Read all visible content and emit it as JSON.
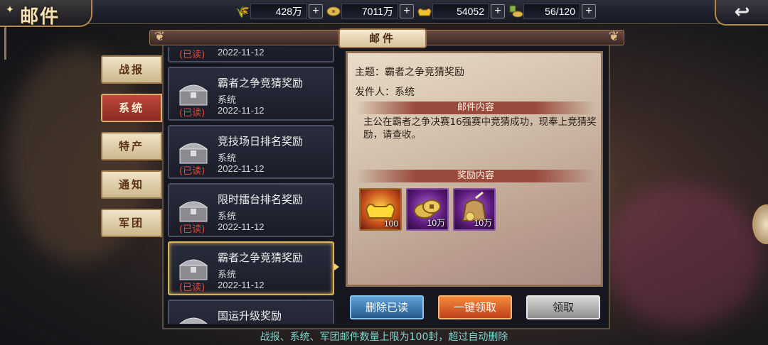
{
  "title": "邮件",
  "resources": [
    {
      "icon": "grain-icon",
      "value": "428万"
    },
    {
      "icon": "coin-icon",
      "value": "7011万"
    },
    {
      "icon": "gold-ingot-icon",
      "value": "54052"
    },
    {
      "icon": "stamina-icon",
      "value": "56/120"
    }
  ],
  "plus_label": "+",
  "header_tab": "邮件",
  "side_tabs": [
    {
      "label": "战报",
      "active": false
    },
    {
      "label": "系统",
      "active": true
    },
    {
      "label": "特产",
      "active": false
    },
    {
      "label": "通知",
      "active": false
    },
    {
      "label": "军团",
      "active": false
    }
  ],
  "mail_items": [
    {
      "subject": "",
      "sender": "",
      "status": "(已读)",
      "date": "2022-11-12",
      "selected": false
    },
    {
      "subject": "霸者之争竞猜奖励",
      "sender": "系统",
      "status": "(已读)",
      "date": "2022-11-12",
      "selected": false
    },
    {
      "subject": "竞技场日排名奖励",
      "sender": "系统",
      "status": "(已读)",
      "date": "2022-11-12",
      "selected": false
    },
    {
      "subject": "限时擂台排名奖励",
      "sender": "系统",
      "status": "(已读)",
      "date": "2022-11-12",
      "selected": false
    },
    {
      "subject": "霸者之争竞猜奖励",
      "sender": "系统",
      "status": "(已读)",
      "date": "2022-11-12",
      "selected": true
    },
    {
      "subject": "国运升级奖励",
      "sender": "",
      "status": "",
      "date": "",
      "selected": false
    }
  ],
  "detail": {
    "subject": "主题：霸者之争竞猜奖励",
    "from": "发件人：系统",
    "content_header": "邮件内容",
    "content": "主公在霸者之争决赛16强赛中竞猜成功，现奉上竞猜奖励，请查收。",
    "reward_header": "奖励内容",
    "rewards": [
      {
        "icon": "gold-ingot-icon",
        "qty": "100"
      },
      {
        "icon": "copper-coin-icon",
        "qty": "10万"
      },
      {
        "icon": "coin-bag-icon",
        "qty": "10万"
      }
    ]
  },
  "buttons": {
    "delete_read": "删除已读",
    "claim_all": "一键领取",
    "claim": "领取"
  },
  "footer_note": "战报、系统、军团邮件数量上限为100封，超过自动删除",
  "colors": {
    "accent_gold": "#d9b35a",
    "read_status": "#e04a3a",
    "footer_text": "#7fd8d0"
  }
}
